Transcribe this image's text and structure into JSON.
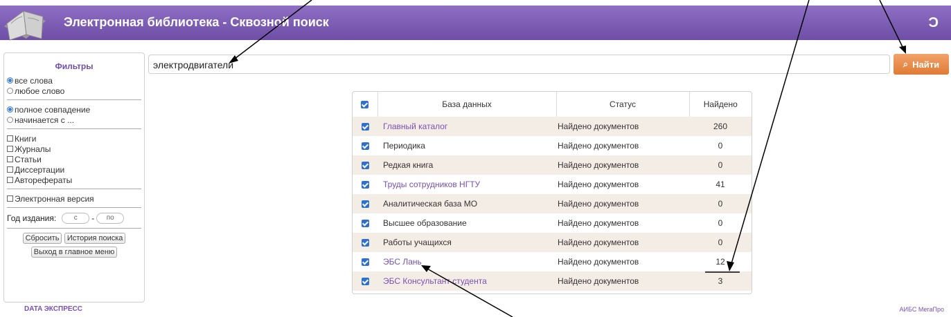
{
  "header": {
    "title": "Электронная библиотека - Сквозной поиск",
    "logo_text": "Ͻ"
  },
  "filters": {
    "title": "Фильтры",
    "words_mode": [
      {
        "label": "все слова",
        "selected": true
      },
      {
        "label": "любое слово",
        "selected": false
      }
    ],
    "match_mode": [
      {
        "label": "полное совпадение",
        "selected": true
      },
      {
        "label": "начинается с ...",
        "selected": false
      }
    ],
    "types": [
      "Книги",
      "Журналы",
      "Статьи",
      "Диссертации",
      "Авторефераты"
    ],
    "electronic": "Электронная версия",
    "year_label": "Год издания:",
    "year_from_placeholder": "с",
    "year_dash": "-",
    "year_to_placeholder": "по",
    "reset_button": "Сбросить",
    "history_button": "История поиска",
    "exit_button": "Выход в главное меню"
  },
  "search": {
    "query": "электродвигатели",
    "button_label": "Найти"
  },
  "results": {
    "headers": [
      "База данных",
      "Статус",
      "Найдено"
    ],
    "rows": [
      {
        "db": "Главный каталог",
        "status": "Найдено документов",
        "count": "260",
        "link": true
      },
      {
        "db": "Периодика",
        "status": "Найдено документов",
        "count": "0",
        "link": false
      },
      {
        "db": "Редкая книга",
        "status": "Найдено документов",
        "count": "0",
        "link": false
      },
      {
        "db": "Труды сотрудников НГТУ",
        "status": "Найдено документов",
        "count": "41",
        "link": true
      },
      {
        "db": "Аналитическая база МО",
        "status": "Найдено документов",
        "count": "0",
        "link": false
      },
      {
        "db": "Высшее образование",
        "status": "Найдено документов",
        "count": "0",
        "link": false
      },
      {
        "db": "Работы учащихся",
        "status": "Найдено документов",
        "count": "0",
        "link": false
      },
      {
        "db": "ЭБС Лань",
        "status": "Найдено документов",
        "count": "12",
        "link": true
      },
      {
        "db": "ЭБС Консультант студента",
        "status": "Найдено документов",
        "count": "3",
        "link": true
      }
    ]
  },
  "footer": {
    "left_logo": "DATA ЭКСПРЕСС",
    "right_logo": "АИБС МегаПро"
  },
  "colors": {
    "header": "#7b5bb3",
    "search_button": "#e8894a",
    "row_shade": "#f4ede6",
    "link": "#7a4fb5"
  }
}
